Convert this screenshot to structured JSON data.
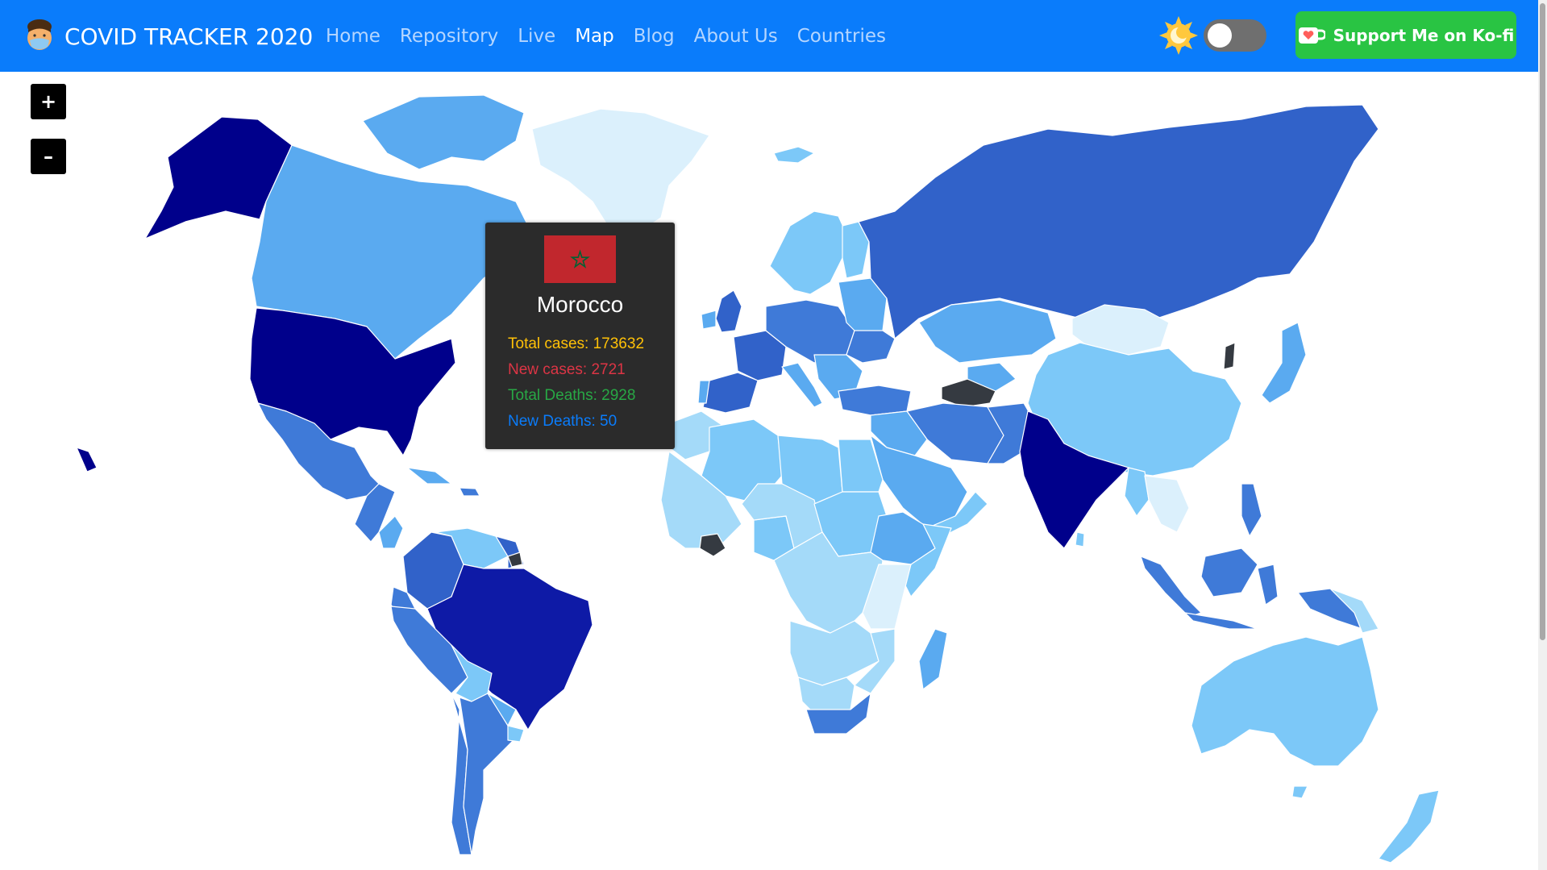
{
  "nav": {
    "brand": "COVID TRACKER 2020",
    "links": [
      "Home",
      "Repository",
      "Live",
      "Map",
      "Blog",
      "About Us",
      "Countries"
    ],
    "active": "Map"
  },
  "kofi": {
    "label": "Support Me on Ko-fi"
  },
  "zoom": {
    "in_label": "+",
    "out_label": "–"
  },
  "tooltip": {
    "country": "Morocco",
    "total_cases": "Total cases: 173632",
    "new_cases": "New cases: 2721",
    "total_deaths": "Total Deaths: 2928",
    "new_deaths": "New Deaths: 50"
  },
  "colors": {
    "navbar": "#0a7cfb",
    "kofi": "#29c443",
    "darkest": "#00008b",
    "very_dark": "#0e1aa6",
    "dark": "#3162c9",
    "medium": "#3f7ad8",
    "mid_light": "#5aaaf0",
    "light": "#7cc8f8",
    "lighter": "#a4daf9",
    "palest": "#dbf0fc",
    "no_data": "#353a41"
  },
  "icons": {
    "brand": "masked-face-icon",
    "theme": "sun-moon-icon",
    "kofi": "kofi-cup-icon",
    "flag": "morocco-flag-icon"
  }
}
